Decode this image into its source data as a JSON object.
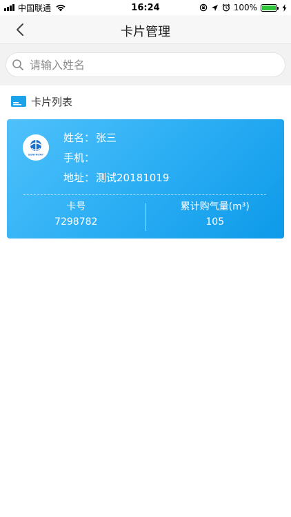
{
  "status_bar": {
    "carrier": "中国联通",
    "time": "16:24",
    "battery_percent": "100%",
    "battery_level": 1.0
  },
  "nav": {
    "title": "卡片管理",
    "back_icon": "chevron-left-icon"
  },
  "search": {
    "placeholder": "请输入姓名",
    "value": ""
  },
  "section": {
    "title": "卡片列表",
    "icon": "card-icon"
  },
  "card": {
    "logo_text": "SUNTRONT",
    "name_label": "姓名：",
    "name_value": "张三",
    "phone_label": "手机：",
    "phone_value": "",
    "address_label": "地址：",
    "address_value": "测试20181019",
    "card_no_label": "卡号",
    "card_no_value": "7298782",
    "gas_label": "累计购气量(m³)",
    "gas_value": "105",
    "colors": {
      "gradient_start": "#4fc1fb",
      "gradient_end": "#0d9ae9"
    }
  }
}
